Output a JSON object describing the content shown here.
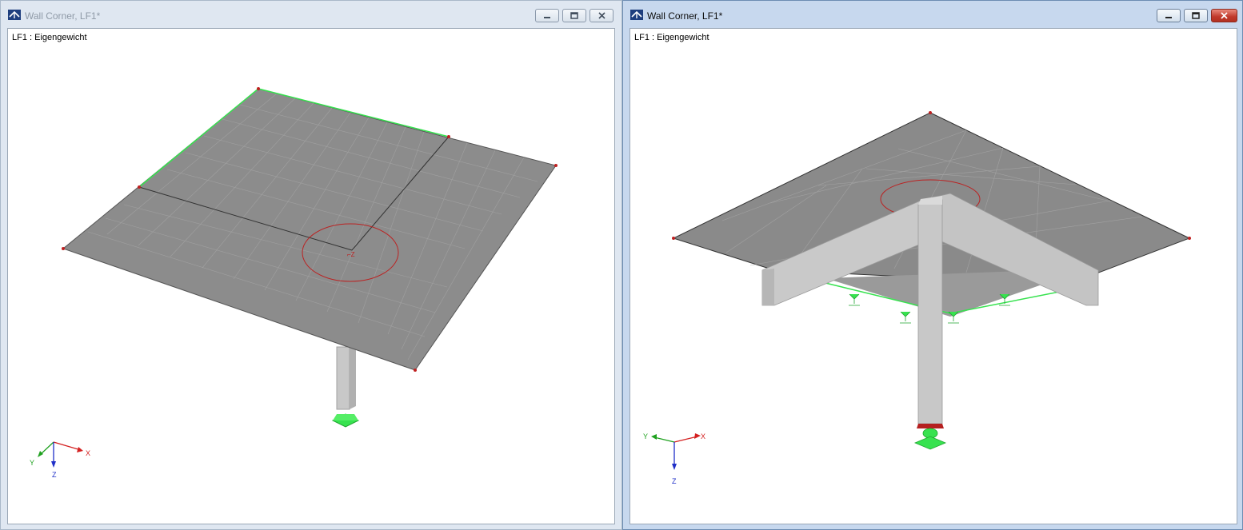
{
  "windows": [
    {
      "title": "Wall Corner, LF1*",
      "load_case_label": "LF1 : Eigengewicht",
      "controls": {
        "minimize": "minimize",
        "restore": "restore",
        "close": "close"
      },
      "active": false,
      "axes": {
        "x": "X",
        "y": "Y",
        "z": "Z"
      }
    },
    {
      "title": "Wall Corner, LF1*",
      "load_case_label": "LF1 : Eigengewicht",
      "controls": {
        "minimize": "minimize",
        "restore": "restore",
        "close": "close"
      },
      "active": true,
      "axes": {
        "x": "X",
        "y": "Y",
        "z": "Z"
      }
    }
  ],
  "colors": {
    "plate": "#8c8c8c",
    "beam": "#c9c9c9",
    "support": "#37e24f",
    "node": "#c02020",
    "axis_x": "#d42020",
    "axis_y": "#1fa11f",
    "axis_z": "#2030c8",
    "close_active": "#c0392b"
  }
}
